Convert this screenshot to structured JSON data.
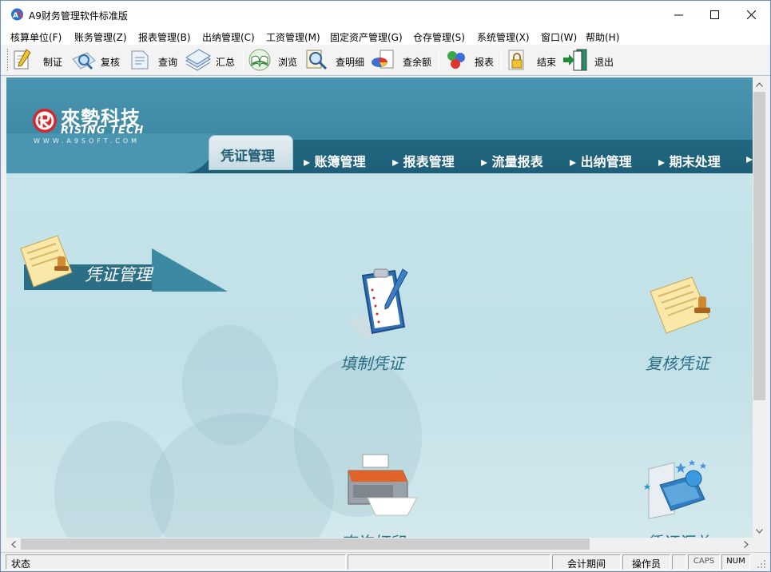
{
  "window": {
    "title": "A9财务管理软件标准版",
    "icon": "app-logo-icon"
  },
  "menu": [
    "核算单位(F)",
    "账务管理(Z)",
    "报表管理(B)",
    "出纳管理(C)",
    "工资管理(M)",
    "固定资产管理(G)",
    "仓存管理(S)",
    "系统管理(X)",
    "窗口(W)",
    "帮助(H)"
  ],
  "toolbar": [
    {
      "label": "制证",
      "icon": "pencil-paper-icon"
    },
    {
      "label": "复核",
      "icon": "magnify-check-icon"
    },
    {
      "label": "查询",
      "icon": "document-search-icon"
    },
    {
      "label": "汇总",
      "icon": "stacked-papers-icon"
    },
    {
      "label": "浏览",
      "icon": "open-book-icon"
    },
    {
      "label": "查明细",
      "icon": "detail-search-icon"
    },
    {
      "label": "查余额",
      "icon": "pie-chart-icon"
    },
    {
      "label": "报表",
      "icon": "report-cubes-icon"
    },
    {
      "label": "结束",
      "icon": "lock-icon"
    },
    {
      "label": "退出",
      "icon": "exit-door-icon"
    }
  ],
  "banner": {
    "logo_cn": "來勢科技",
    "logo_en": "RISING TECH",
    "logo_url": "WWW.A9SOFT.COM",
    "active_tab": "凭证管理",
    "tabs": [
      "账簿管理",
      "报表管理",
      "流量报表",
      "出纳管理",
      "期末处理"
    ]
  },
  "section": {
    "title": "凭证管理",
    "functions": [
      "填制凭证",
      "复核凭证",
      "查询打印",
      "凭证汇总"
    ]
  },
  "statusbar": {
    "status": "状态",
    "period_label": "会计期间",
    "operator_label": "操作员",
    "caps": "CAPS",
    "num": "NUM"
  },
  "colors": {
    "banner": "#3f8ba6",
    "tab_strip": "#1d5f78",
    "label_teal": "#2b6f86",
    "content_bg": "#c2e1e8"
  }
}
